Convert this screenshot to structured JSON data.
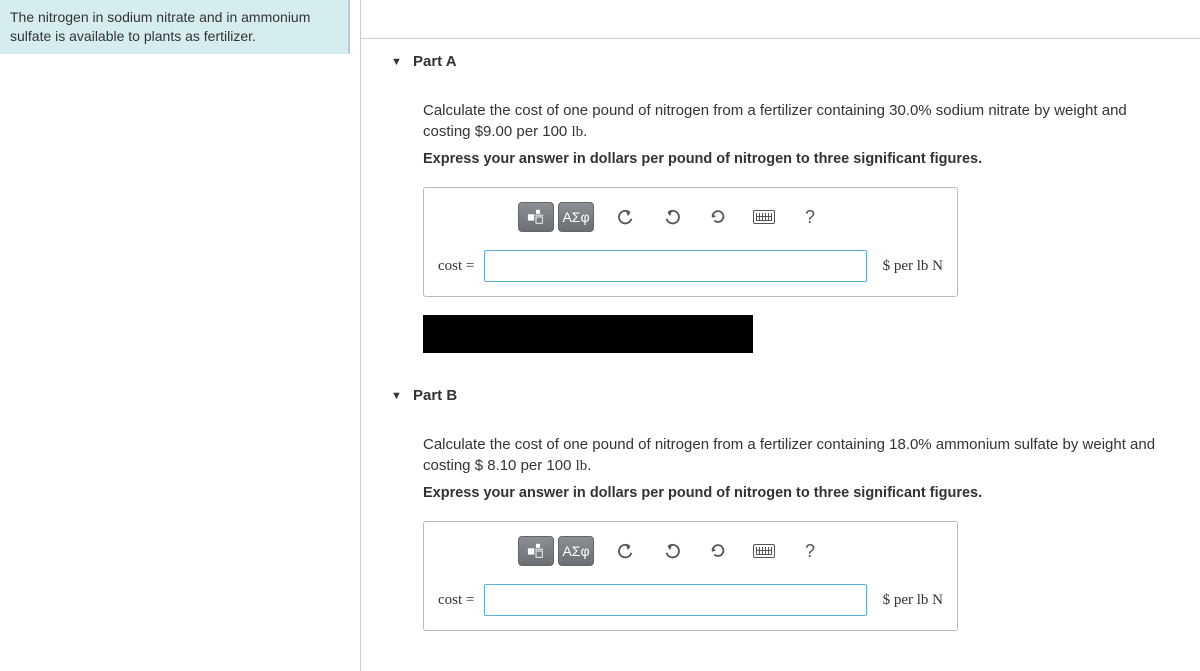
{
  "hint": "The nitrogen in sodium nitrate and in ammonium sulfate is available to plants as fertilizer.",
  "partA": {
    "title": "Part A",
    "prompt_1": "Calculate the cost of one pound of nitrogen from a fertilizer containing 30.0% sodium nitrate by weight and costing $9.00 per 100 ",
    "prompt_unit": "lb",
    "prompt_2": ".",
    "instruction": "Express your answer in dollars per pound of nitrogen to three significant figures.",
    "label": "cost =",
    "unit": "$ per lb N",
    "greek": "ΑΣφ",
    "help": "?"
  },
  "partB": {
    "title": "Part B",
    "prompt_1": "Calculate the cost of one pound of nitrogen from a fertilizer containing 18.0% ammonium sulfate by weight and costing $ 8.10 per 100 ",
    "prompt_unit": "lb",
    "prompt_2": ".",
    "instruction": "Express your answer in dollars per pound of nitrogen to three significant figures.",
    "label": "cost =",
    "unit": "$ per lb N",
    "greek": "ΑΣφ",
    "help": "?"
  }
}
